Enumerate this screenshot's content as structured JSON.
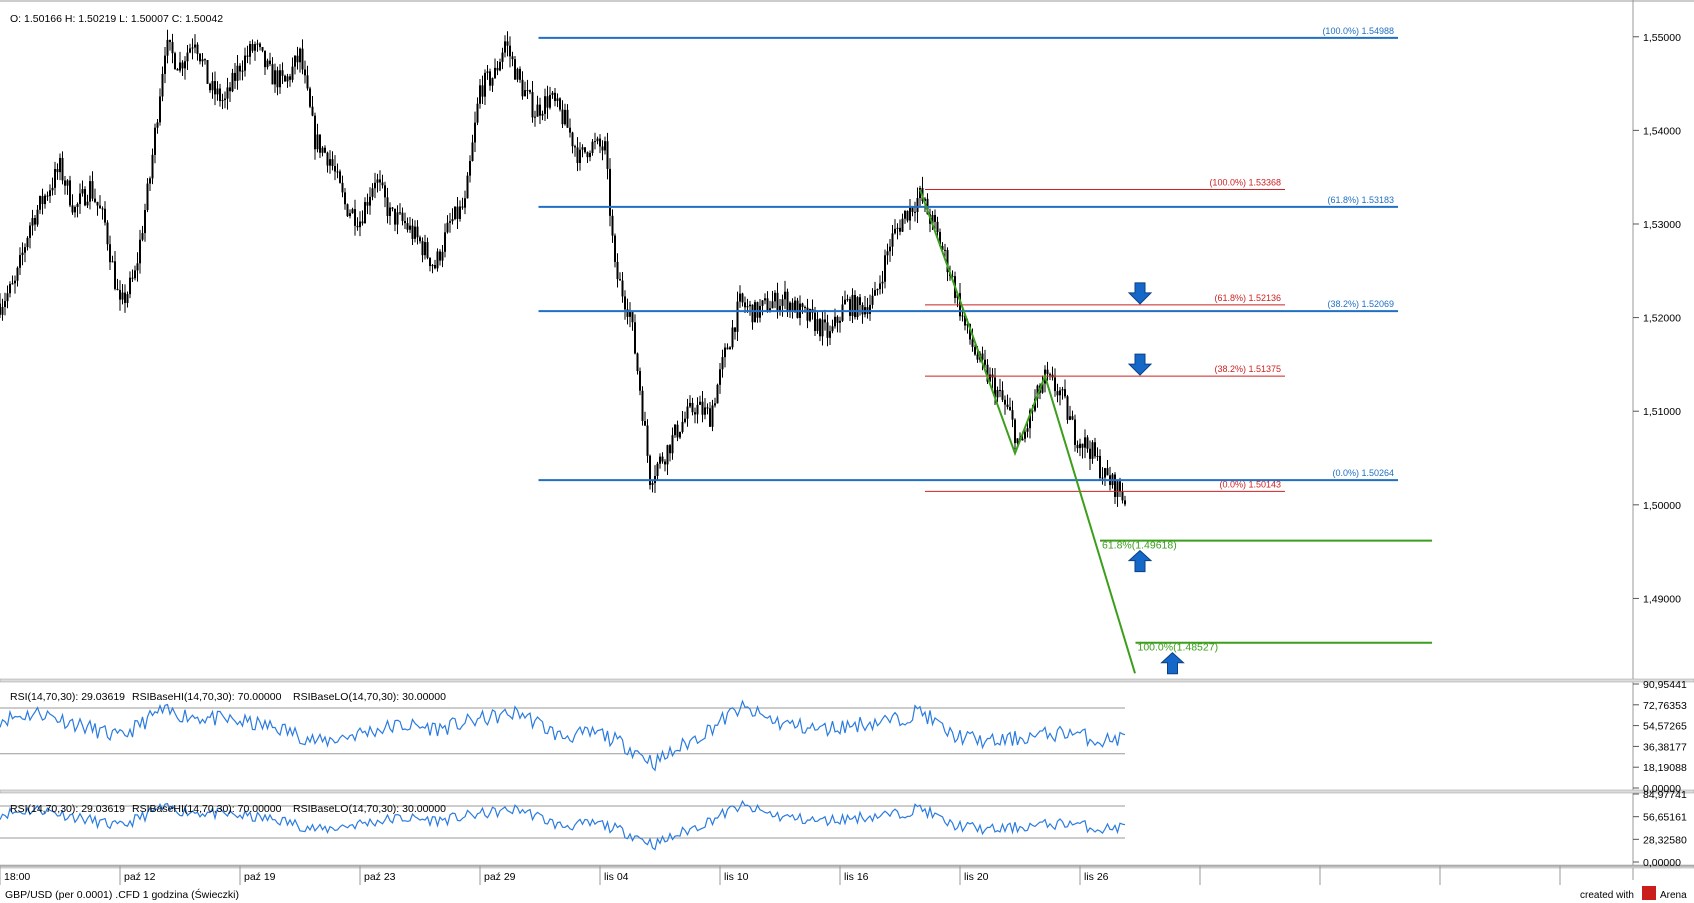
{
  "colors": {
    "background": "#ffffff",
    "candle": "#000000",
    "fib_blue": "#1f6fc4",
    "fib_red": "#cc2222",
    "fib_green": "#3b9e1c",
    "rsi": "#2a7be0",
    "rsi_base": "#9a9a9a",
    "grid": "#c8c8c8",
    "arrow_fill": "#1668c8"
  },
  "header": {
    "ohlc": "O: 1.50166 H: 1.50219 L: 1.50007 C: 1.50042"
  },
  "footer": {
    "instrument": "GBP/USD (per 0.0001) .CFD 1 godzina (Świeczki)",
    "created_with": "created with",
    "brand": "Arena"
  },
  "chart_data": [
    {
      "type": "candlestick",
      "instrument": "GBP/USD",
      "timeframe": "1 godzina",
      "x_labels": [
        "18:00",
        "paź 12",
        "paź 19",
        "paź 23",
        "paź 29",
        "lis 04",
        "lis 10",
        "lis 16",
        "lis 20",
        "lis 26"
      ],
      "y_ticks": [
        "1,55000",
        "1,54000",
        "1,53000",
        "1,52000",
        "1,51000",
        "1,50000",
        "1,49000"
      ],
      "ylim": [
        1.4815,
        1.5535
      ],
      "last_price": 1.50042,
      "price_path": [
        [
          0,
          1.5215
        ],
        [
          3,
          1.5235
        ],
        [
          6,
          1.53
        ],
        [
          9,
          1.533
        ],
        [
          12,
          1.536
        ],
        [
          15,
          1.5315
        ],
        [
          18,
          1.534
        ],
        [
          21,
          1.53
        ],
        [
          24,
          1.521
        ],
        [
          27,
          1.5245
        ],
        [
          30,
          1.535
        ],
        [
          33,
          1.549
        ],
        [
          36,
          1.547
        ],
        [
          39,
          1.55
        ],
        [
          42,
          1.5445
        ],
        [
          45,
          1.543
        ],
        [
          48,
          1.547
        ],
        [
          51,
          1.549
        ],
        [
          54,
          1.546
        ],
        [
          57,
          1.545
        ],
        [
          60,
          1.548
        ],
        [
          63,
          1.539
        ],
        [
          66,
          1.537
        ],
        [
          69,
          1.532
        ],
        [
          72,
          1.5305
        ],
        [
          75,
          1.535
        ],
        [
          78,
          1.531
        ],
        [
          81,
          1.53
        ],
        [
          84,
          1.528
        ],
        [
          87,
          1.5255
        ],
        [
          90,
          1.53
        ],
        [
          93,
          1.532
        ],
        [
          96,
          1.5445
        ],
        [
          99,
          1.546
        ],
        [
          101,
          1.5495
        ],
        [
          104,
          1.545
        ],
        [
          107,
          1.542
        ],
        [
          110,
          1.5435
        ],
        [
          113,
          1.541
        ],
        [
          116,
          1.537
        ],
        [
          118,
          1.5385
        ],
        [
          121,
          1.538
        ],
        [
          123,
          1.525
        ],
        [
          126,
          1.5205
        ],
        [
          128,
          1.5125
        ],
        [
          130,
          1.503
        ],
        [
          133,
          1.5055
        ],
        [
          136,
          1.5085
        ],
        [
          139,
          1.5105
        ],
        [
          142,
          1.5095
        ],
        [
          145,
          1.516
        ],
        [
          148,
          1.5215
        ],
        [
          151,
          1.5205
        ],
        [
          154,
          1.5215
        ],
        [
          157,
          1.522
        ],
        [
          160,
          1.5205
        ],
        [
          163,
          1.5195
        ],
        [
          166,
          1.518
        ],
        [
          169,
          1.5215
        ],
        [
          172,
          1.521
        ],
        [
          175,
          1.522
        ],
        [
          178,
          1.528
        ],
        [
          181,
          1.531
        ],
        [
          184,
          1.533
        ],
        [
          187,
          1.5295
        ],
        [
          190,
          1.525
        ],
        [
          193,
          1.519
        ],
        [
          196,
          1.515
        ],
        [
          199,
          1.5125
        ],
        [
          202,
          1.5095
        ],
        [
          204,
          1.506
        ],
        [
          207,
          1.511
        ],
        [
          209,
          1.5135
        ],
        [
          212,
          1.512
        ],
        [
          215,
          1.5075
        ],
        [
          218,
          1.506
        ],
        [
          221,
          1.503
        ],
        [
          224,
          1.5015
        ],
        [
          225,
          1.50042
        ]
      ],
      "retracement_blue": {
        "levels": [
          {
            "label": "(100.0%) 1.54988",
            "value": 1.54988
          },
          {
            "label": "(61.8%) 1.53183",
            "value": 1.53183
          },
          {
            "label": "(38.2%) 1.52069",
            "value": 1.52069
          },
          {
            "label": "(0.0%) 1.50264",
            "value": 1.50264
          }
        ]
      },
      "retracement_red": {
        "levels": [
          {
            "label": "(100.0%) 1.53368",
            "value": 1.53368
          },
          {
            "label": "(61.8%) 1.52136",
            "value": 1.52136
          },
          {
            "label": "(38.2%) 1.51375",
            "value": 1.51375
          },
          {
            "label": "(0.0%) 1.50143",
            "value": 1.50143
          }
        ]
      },
      "projection_green": {
        "swing": [
          {
            "bar": 184,
            "value": 1.53368
          },
          {
            "bar": 203,
            "value": 1.5055
          },
          {
            "bar": 209,
            "value": 1.51375
          },
          {
            "bar": 227,
            "value": 1.482
          }
        ],
        "levels": [
          {
            "label": "61.8%(1.49618)",
            "value": 1.49618
          },
          {
            "label": "100.0%(1.48527)",
            "value": 1.48527
          }
        ]
      },
      "arrows": [
        {
          "direction": "down",
          "level": 1.52136
        },
        {
          "direction": "down",
          "level": 1.51375
        },
        {
          "direction": "up",
          "level": 1.49618
        },
        {
          "direction": "up",
          "level": 1.48527
        }
      ]
    },
    {
      "type": "line",
      "panel": "rsi-1",
      "legend": [
        "RSI(14,70,30): 29.03619",
        "RSIBaseHI(14,70,30): 70.00000",
        "RSIBaseLO(14,70,30): 30.00000"
      ],
      "y_ticks": [
        "90,95441",
        "72,76353",
        "54,57265",
        "36,38177",
        "18,19088",
        "0,00000"
      ],
      "ylim": [
        0,
        90.95441
      ],
      "base_hi": 70,
      "base_lo": 30,
      "rsi_path": [
        [
          0,
          60
        ],
        [
          8,
          66
        ],
        [
          16,
          55
        ],
        [
          24,
          44
        ],
        [
          32,
          67
        ],
        [
          40,
          62
        ],
        [
          48,
          58
        ],
        [
          56,
          52
        ],
        [
          64,
          40
        ],
        [
          72,
          48
        ],
        [
          80,
          55
        ],
        [
          88,
          52
        ],
        [
          96,
          60
        ],
        [
          104,
          66
        ],
        [
          112,
          45
        ],
        [
          120,
          48
        ],
        [
          126,
          35
        ],
        [
          131,
          22
        ],
        [
          140,
          46
        ],
        [
          148,
          70
        ],
        [
          156,
          57
        ],
        [
          164,
          51
        ],
        [
          172,
          56
        ],
        [
          180,
          60
        ],
        [
          184,
          68
        ],
        [
          190,
          47
        ],
        [
          198,
          40
        ],
        [
          206,
          45
        ],
        [
          214,
          49
        ],
        [
          220,
          41
        ],
        [
          225,
          44
        ]
      ]
    },
    {
      "type": "line",
      "panel": "rsi-2",
      "legend": [
        "RSI(14,70,30): 29.03619",
        "RSIBaseHI(14,70,30): 70.00000",
        "RSIBaseLO(14,70,30): 30.00000"
      ],
      "y_ticks": [
        "84,97741",
        "56,65161",
        "28,32580",
        "0,00000"
      ],
      "ylim": [
        0,
        84.97741
      ],
      "base_hi": 70,
      "base_lo": 30,
      "rsi_path": [
        [
          0,
          60
        ],
        [
          8,
          66
        ],
        [
          16,
          55
        ],
        [
          24,
          44
        ],
        [
          32,
          67
        ],
        [
          40,
          62
        ],
        [
          48,
          58
        ],
        [
          56,
          52
        ],
        [
          64,
          40
        ],
        [
          72,
          48
        ],
        [
          80,
          55
        ],
        [
          88,
          52
        ],
        [
          96,
          60
        ],
        [
          104,
          66
        ],
        [
          112,
          45
        ],
        [
          120,
          48
        ],
        [
          126,
          35
        ],
        [
          131,
          22
        ],
        [
          140,
          46
        ],
        [
          148,
          70
        ],
        [
          156,
          57
        ],
        [
          164,
          51
        ],
        [
          172,
          56
        ],
        [
          180,
          60
        ],
        [
          184,
          68
        ],
        [
          190,
          47
        ],
        [
          198,
          40
        ],
        [
          206,
          45
        ],
        [
          214,
          49
        ],
        [
          220,
          41
        ],
        [
          225,
          44
        ]
      ]
    }
  ]
}
